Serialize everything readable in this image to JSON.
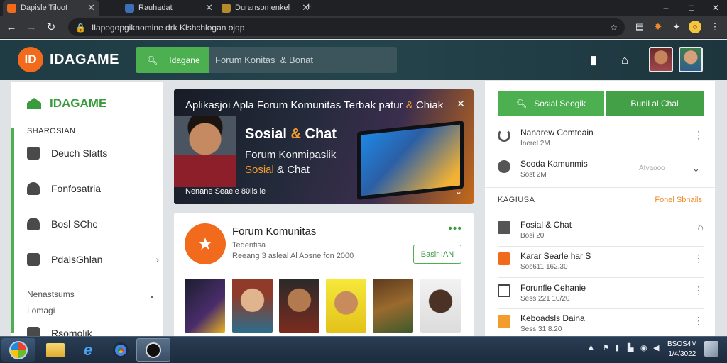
{
  "browser": {
    "tabs": [
      {
        "title": "Dapisle Tiloot",
        "favicon_color": "#f26a1b"
      },
      {
        "title": "Rauhadat",
        "favicon_color": "#3b6fb6"
      },
      {
        "title": "Duransomenkel",
        "favicon_color": "#b58a2a"
      }
    ],
    "new_tab_icon": "+",
    "window_controls": [
      "–",
      "□",
      "✕"
    ],
    "address": "Ilapogopgiknomine drk Klshchlogan ojqp",
    "profile_initial": "☺"
  },
  "site": {
    "brand": "IDAGAME",
    "logo_glyph": "ID",
    "search": {
      "scope_label": "Idagane",
      "placeholder": "Forum Konitas  & Bonat"
    }
  },
  "sidebar": {
    "brand": "IDAGAME",
    "section_title": "SHAROSIAN",
    "items": [
      {
        "label": "Deuch Slatts"
      },
      {
        "label": "Fonfosatria"
      },
      {
        "label": "Bosl SChc"
      },
      {
        "label": "PdalsGhlan"
      }
    ],
    "section2_title": "Nenastsums",
    "section2_sub": "Lomagi",
    "last_item": "Rsomolik"
  },
  "hero": {
    "title_pre": "Aplikasjoi Apla Forum Komunitas Terbak patur ",
    "title_amp": "&",
    "title_post": " Chiak",
    "big_pre": "Sosial ",
    "big_amp": "&",
    "big_post": " Chat",
    "sub_line1": "Forum Konmipaslik",
    "sub_line2_accent": "Sosial",
    "sub_line2_rest": " & Chat",
    "caption": "Nenane Seaeie 80lis le"
  },
  "forum_card": {
    "title": "Forum Komunitas",
    "meta_line1": "Tedentisa",
    "meta_line2": "Reeang 3 asleal Al Aosne fon 2000",
    "button_label": "Baslr IAN",
    "more_glyph": "•••"
  },
  "right_panel": {
    "btn_left": "Sosial Seogik",
    "btn_right": "Bunil al Chal",
    "rows_top": [
      {
        "title": "Nanarew Comtoain",
        "sub": "Inerel 2M"
      },
      {
        "title": "Sooda Kamunmis",
        "sub": "Sost 2M"
      }
    ],
    "tag": "Atvaooo",
    "section_title": "KAGIUSA",
    "section_link": "Fonel Sbnails",
    "rows_bottom": [
      {
        "title": "Fosial & Chat",
        "sub": "Bosi 20"
      },
      {
        "title": "Karar Searle har S",
        "sub": "Sos611 162.30"
      },
      {
        "title": "Forunfle Cehanie",
        "sub": "Sess 221 10/20"
      },
      {
        "title": "Keboadsls Daina",
        "sub": "Sess 31 8.20"
      }
    ]
  },
  "taskbar": {
    "clock_time": "BSOS4M",
    "clock_date": "1/4/3022",
    "tray_arrow": "▲"
  },
  "colors": {
    "header_bg": "#1f3b44",
    "accent_green": "#4caf50",
    "accent_orange": "#f26a1b"
  }
}
